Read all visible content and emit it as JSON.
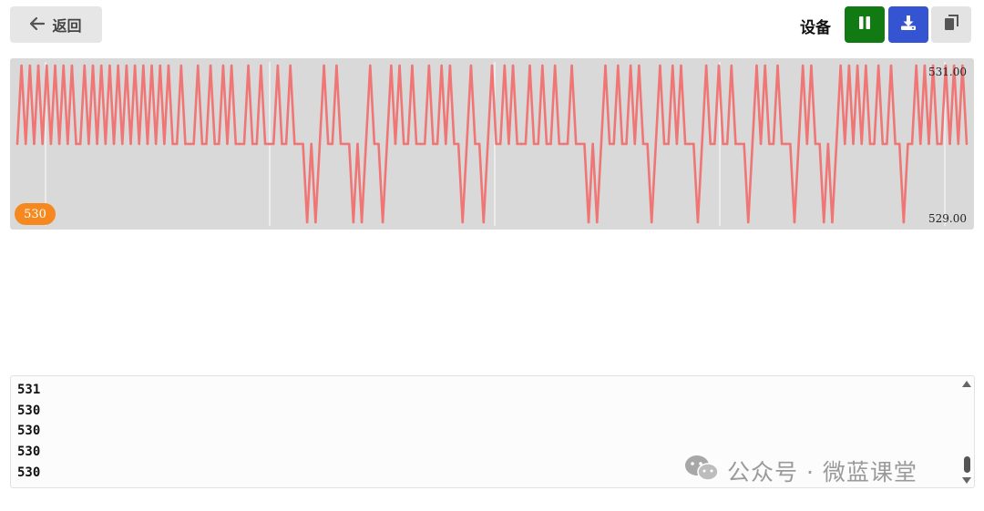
{
  "header": {
    "back_label": "返回",
    "device_label": "设备",
    "back_icon": "arrow-left-icon",
    "pause_icon": "pause-icon",
    "download_icon": "download-icon",
    "copy_icon": "copy-icon",
    "colors": {
      "pause_bg": "#127a12",
      "download_bg": "#3454d1",
      "copy_bg": "#e3e3e3"
    }
  },
  "chart": {
    "ymax_label": "531.00",
    "ymin_label": "529.00",
    "current_value": "530",
    "line_color": "#f07575",
    "badge_color": "#f5891f"
  },
  "chart_data": {
    "type": "line",
    "ylim": [
      529,
      531
    ],
    "grid": true,
    "series": [
      {
        "values": [
          530,
          531,
          530,
          531,
          530,
          531,
          530,
          531,
          530,
          531,
          530,
          531,
          530,
          531,
          530,
          530,
          531,
          530,
          531,
          530,
          531,
          530,
          531,
          530,
          531,
          530,
          531,
          530,
          531,
          530,
          531,
          530,
          531,
          530,
          531,
          530,
          531,
          530,
          530,
          531,
          530,
          530,
          530,
          531,
          530,
          530,
          531,
          530,
          530,
          531,
          530,
          531,
          530,
          530,
          530,
          531,
          530,
          530,
          531,
          530,
          530,
          530,
          531,
          530,
          530,
          531,
          530,
          530,
          530,
          529,
          530,
          529,
          530,
          531,
          530,
          530,
          531,
          530,
          530,
          530,
          529,
          530,
          529,
          530,
          531,
          530,
          530,
          529,
          530,
          531,
          530,
          531,
          530,
          530,
          531,
          530,
          530,
          530,
          531,
          530,
          530,
          531,
          530,
          531,
          530,
          530,
          529,
          530,
          531,
          530,
          530,
          529,
          530,
          531,
          530,
          530,
          531,
          530,
          531,
          530,
          530,
          530,
          531,
          530,
          530,
          531,
          530,
          530,
          531,
          530,
          530,
          530,
          531,
          530,
          530,
          530,
          529,
          530,
          529,
          530,
          531,
          530,
          530,
          531,
          530,
          530,
          531,
          530,
          531,
          530,
          530,
          529,
          530,
          531,
          530,
          530,
          531,
          530,
          531,
          530,
          530,
          530,
          529,
          530,
          531,
          530,
          530,
          531,
          530,
          530,
          531,
          530,
          530,
          530,
          529,
          530,
          531,
          530,
          531,
          530,
          530,
          531,
          530,
          530,
          530,
          529,
          530,
          531,
          530,
          531,
          530,
          530,
          529,
          530,
          529,
          530,
          531,
          530,
          531,
          530,
          531,
          530,
          531,
          530,
          530,
          531,
          530,
          530,
          531,
          530,
          530,
          529,
          530,
          530,
          531,
          530,
          531,
          530,
          531,
          530,
          530,
          531,
          530,
          531,
          530,
          531,
          530
        ]
      }
    ]
  },
  "log": {
    "lines": [
      "531",
      "530",
      "530",
      "530",
      "530"
    ]
  },
  "watermark": {
    "text": "公众号 · 微蓝课堂",
    "icon": "wechat-icon"
  }
}
